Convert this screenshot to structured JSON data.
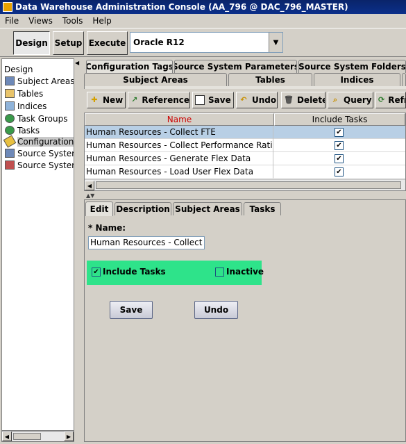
{
  "window": {
    "title": "Data Warehouse Administration Console (AA_796 @ DAC_796_MASTER)"
  },
  "menu": [
    "File",
    "Views",
    "Tools",
    "Help"
  ],
  "toolbar": {
    "buttons": [
      "Design",
      "Setup",
      "Execute"
    ],
    "active": "Design",
    "container_value": "Oracle R12"
  },
  "tree": {
    "root": "Design",
    "items": [
      {
        "label": "Subject Areas",
        "icon": "table-grid-icon"
      },
      {
        "label": "Tables",
        "icon": "table-icon"
      },
      {
        "label": "Indices",
        "icon": "index-icon"
      },
      {
        "label": "Task Groups",
        "icon": "gears-icon"
      },
      {
        "label": "Tasks",
        "icon": "gear-icon"
      },
      {
        "label": "Configuration Tags",
        "icon": "tag-icon",
        "selected": true
      },
      {
        "label": "Source System Parameters",
        "icon": "parameters-icon"
      },
      {
        "label": "Source System Folders",
        "icon": "folders-icon"
      }
    ]
  },
  "tabs": {
    "row1": [
      "Configuration Tags",
      "Source System Parameters",
      "Source System Folders"
    ],
    "row2": [
      "Subject Areas",
      "Tables",
      "Indices"
    ],
    "active": "Configuration Tags"
  },
  "grid_toolbar": {
    "new": "New",
    "reference": "Reference",
    "save": "Save",
    "undo": "Undo",
    "delete": "Delete",
    "query": "Query",
    "refresh": "Refresh"
  },
  "grid": {
    "columns": [
      "Name",
      "Include Tasks"
    ],
    "rows": [
      {
        "name": "Human Resources - Collect FTE",
        "include_tasks": true,
        "selected": true
      },
      {
        "name": "Human Resources - Collect Performance Ratin...",
        "include_tasks": true
      },
      {
        "name": "Human Resources - Generate Flex Data",
        "include_tasks": true
      },
      {
        "name": "Human Resources - Load User Flex Data",
        "include_tasks": true
      }
    ],
    "check_glyph": "✔"
  },
  "detail": {
    "tabs": [
      "Edit",
      "Description",
      "Subject Areas",
      "Tasks"
    ],
    "active_tab": "Edit",
    "name_label": "* Name:",
    "name_value": "Human Resources - Collect FTE",
    "include_tasks_label": "Include Tasks",
    "include_tasks_checked": true,
    "inactive_label": "Inactive",
    "inactive_checked": false,
    "save_label": "Save",
    "undo_label": "Undo"
  },
  "colors": {
    "title_bar": "#0a246a",
    "highlight": "#2ee38a",
    "name_header": "#cc0000",
    "selected_row": "#b8cfe5"
  }
}
